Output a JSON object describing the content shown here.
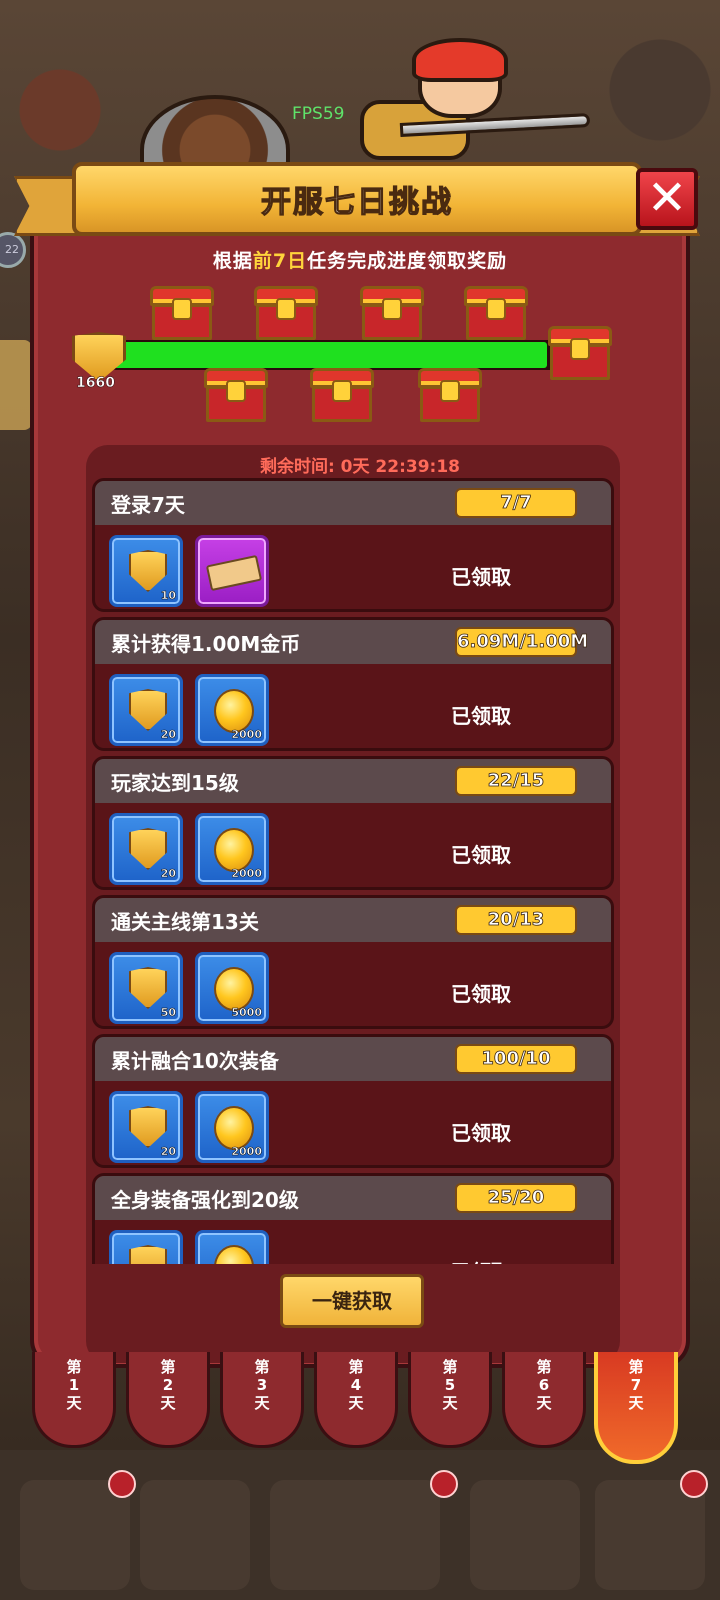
{
  "overlay": {
    "fps": "FPS59",
    "side_badge": "22"
  },
  "dialog": {
    "title": "开服七日挑战",
    "close_label": "✕",
    "subtitle_prefix": "根据",
    "subtitle_highlight": "前7日",
    "subtitle_suffix": "任务完成进度领取奖励",
    "points": "1660",
    "progress": 0.97,
    "timer": "剩余时间: 0天 22:39:18",
    "collect_all_label": "一键获取"
  },
  "tasks": [
    {
      "title": "登录7天",
      "progress": "7/7",
      "status": "已领取",
      "rewards": [
        {
          "icon": "shield-icon",
          "count": "10"
        },
        {
          "icon": "ticket-icon",
          "count": ""
        }
      ]
    },
    {
      "title": "累计获得1.00M金币",
      "progress": "6.09M/1.00M",
      "status": "已领取",
      "rewards": [
        {
          "icon": "shield-icon",
          "count": "20"
        },
        {
          "icon": "coin-icon",
          "count": "2000"
        }
      ]
    },
    {
      "title": "玩家达到15级",
      "progress": "22/15",
      "status": "已领取",
      "rewards": [
        {
          "icon": "shield-icon",
          "count": "20"
        },
        {
          "icon": "coin-icon",
          "count": "2000"
        }
      ]
    },
    {
      "title": "通关主线第13关",
      "progress": "20/13",
      "status": "已领取",
      "rewards": [
        {
          "icon": "shield-icon",
          "count": "50"
        },
        {
          "icon": "coin-icon",
          "count": "5000"
        }
      ]
    },
    {
      "title": "累计融合10次装备",
      "progress": "100/10",
      "status": "已领取",
      "rewards": [
        {
          "icon": "shield-icon",
          "count": "20"
        },
        {
          "icon": "coin-icon",
          "count": "2000"
        }
      ]
    },
    {
      "title": "全身装备强化到20级",
      "progress": "25/20",
      "status": "已领取",
      "rewards": [
        {
          "icon": "shield-icon",
          "count": ""
        },
        {
          "icon": "coin-icon",
          "count": ""
        }
      ]
    }
  ],
  "day_tabs": [
    {
      "l1": "第",
      "l2": "1",
      "l3": "天"
    },
    {
      "l1": "第",
      "l2": "2",
      "l3": "天"
    },
    {
      "l1": "第",
      "l2": "3",
      "l3": "天"
    },
    {
      "l1": "第",
      "l2": "4",
      "l3": "天"
    },
    {
      "l1": "第",
      "l2": "5",
      "l3": "天"
    },
    {
      "l1": "第",
      "l2": "6",
      "l3": "天"
    },
    {
      "l1": "第",
      "l2": "7",
      "l3": "天",
      "active": true
    }
  ],
  "colors": {
    "panel": "#8e2a2e",
    "progress_fill": "#1fe01f",
    "highlight": "#ffd43b",
    "timer": "#ff6b5a"
  }
}
